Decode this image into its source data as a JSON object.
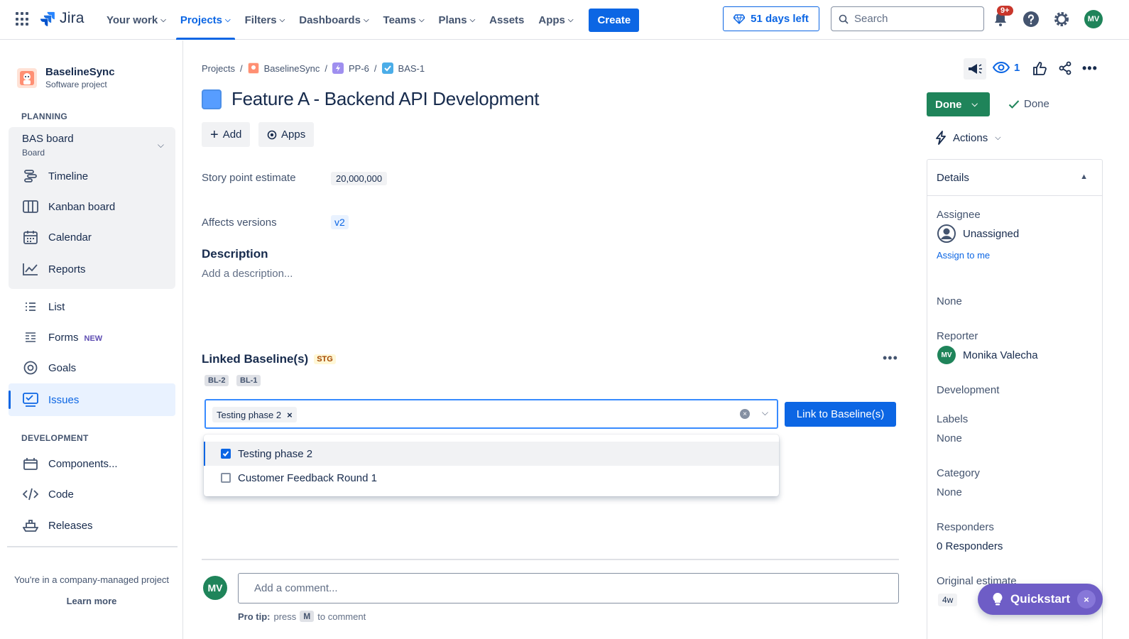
{
  "topnav": {
    "logo_text": "Jira",
    "items": [
      {
        "label": "Your work",
        "chevron": true
      },
      {
        "label": "Projects",
        "chevron": true,
        "active": true
      },
      {
        "label": "Filters",
        "chevron": true
      },
      {
        "label": "Dashboards",
        "chevron": true
      },
      {
        "label": "Teams",
        "chevron": true
      },
      {
        "label": "Plans",
        "chevron": true
      },
      {
        "label": "Assets",
        "chevron": false
      },
      {
        "label": "Apps",
        "chevron": true
      }
    ],
    "create_label": "Create",
    "trial_label": "51 days left",
    "search_placeholder": "Search",
    "notifications_badge": "9+",
    "user_initials": "MV",
    "icons": [
      "app-switcher-icon",
      "jira-logo-icon",
      "diamond-icon",
      "search-icon",
      "bell-icon",
      "help-icon",
      "gear-icon"
    ]
  },
  "sidebar": {
    "project_name": "BaselineSync",
    "project_type": "Software project",
    "planning_title": "PLANNING",
    "board": {
      "title": "BAS board",
      "subtitle": "Board"
    },
    "planning_items": [
      "Timeline",
      "Kanban board",
      "Calendar",
      "Reports"
    ],
    "items": [
      "List",
      "Forms",
      "Goals",
      "Issues"
    ],
    "forms_tag": "NEW",
    "development_title": "DEVELOPMENT",
    "development_items": [
      "Components...",
      "Code",
      "Releases"
    ],
    "footer_text": "You're in a company-managed project",
    "learn_more": "Learn more"
  },
  "breadcrumb": {
    "items": [
      "Projects",
      "BaselineSync",
      "PP-6",
      "BAS-1"
    ],
    "separator": "/"
  },
  "issue": {
    "title": "Feature A - Backend API Development",
    "add_label": "Add",
    "apps_label": "Apps",
    "story_points_label": "Story point estimate",
    "story_points_value": "20,000,000",
    "affects_versions_label": "Affects versions",
    "affects_versions_value": "v2",
    "description_heading": "Description",
    "description_placeholder": "Add a description..."
  },
  "linked_baselines": {
    "title": "Linked Baseline(s)",
    "env_tag": "STG",
    "more_label": "•••",
    "chips": [
      "BL-2",
      "BL-1"
    ],
    "selected_chip": "Testing phase 2",
    "link_button": "Link to Baseline(s)",
    "options": [
      {
        "label": "Testing phase 2",
        "checked": true
      },
      {
        "label": "Customer Feedback Round 1",
        "checked": false
      }
    ]
  },
  "comment": {
    "avatar_initials": "MV",
    "placeholder": "Add a comment...",
    "protip_prefix": "Pro tip:",
    "protip_press": "press",
    "protip_key": "M",
    "protip_suffix": "to comment"
  },
  "right_panel": {
    "watchers_count": "1",
    "status_label": "Done",
    "resolution_label": "Done",
    "actions_label": "Actions",
    "details_heading": "Details",
    "assignee_label": "Assignee",
    "assignee_value": "Unassigned",
    "assign_to_me": "Assign to me",
    "none_value": "None",
    "reporter_label": "Reporter",
    "reporter_initials": "MV",
    "reporter_name": "Monika Valecha",
    "development_label": "Development",
    "labels_label": "Labels",
    "labels_value": "None",
    "category_label": "Category",
    "category_value": "None",
    "responders_label": "Responders",
    "responders_value": "0 Responders",
    "original_estimate_label": "Original estimate",
    "original_estimate_value": "4w"
  },
  "quickstart": {
    "label": "Quickstart",
    "close": "×"
  },
  "colors": {
    "primary": "#0c66e4",
    "done_green": "#1f845a",
    "quickstart_purple": "#6e5dc6",
    "badge_red": "#c9372c"
  }
}
